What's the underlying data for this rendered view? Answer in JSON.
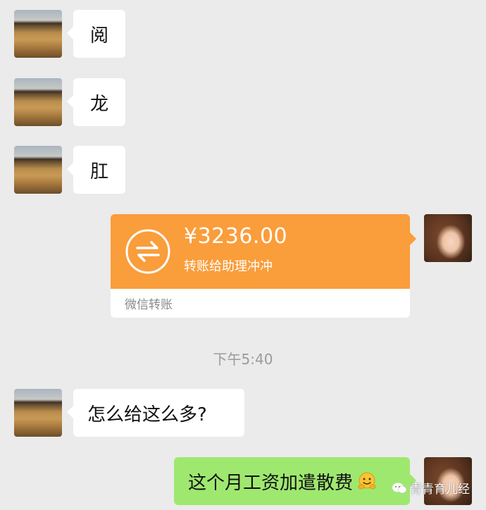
{
  "messages": {
    "m1": {
      "text": "阅"
    },
    "m2": {
      "text": "龙"
    },
    "m3": {
      "text": "肛"
    },
    "transfer": {
      "amount": "¥3236.00",
      "note": "转账给助理冲冲",
      "footer": "微信转账",
      "icon": "transfer-arrows-icon",
      "color": "#fa9d3b"
    },
    "timestamp": "下午5:40",
    "m4": {
      "text": "怎么给这么多?"
    },
    "m5": {
      "text": "这个月工资加遣散费",
      "emoji": "hugging-face-emoji"
    }
  },
  "watermark": {
    "text": "青青育儿经",
    "icon": "wechat-official-account-icon"
  },
  "colors": {
    "background": "#ebebeb",
    "bubble_white": "#ffffff",
    "bubble_green": "#9fe870",
    "transfer_orange": "#fa9d3b"
  }
}
